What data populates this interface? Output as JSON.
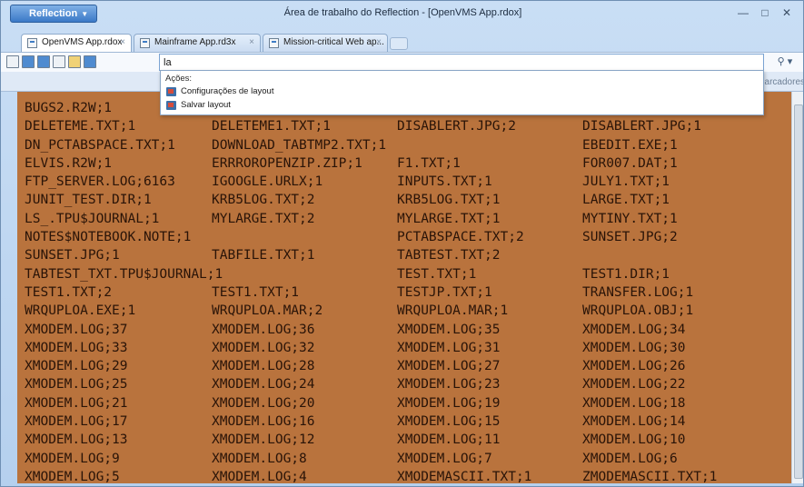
{
  "window": {
    "app_menu_label": "Reflection",
    "title": "Área de trabalho do Reflection - [OpenVMS App.rdox]",
    "minimize": "—",
    "maximize": "□",
    "close": "✕"
  },
  "tabs": [
    {
      "label": "OpenVMS App.rdox",
      "close": "×"
    },
    {
      "label": "Mainframe App.rd3x",
      "close": "×"
    },
    {
      "label": "Mission-critical Web ap...",
      "close": "×"
    }
  ],
  "search": {
    "value": "la",
    "button_label": "⚲ ▾"
  },
  "ribbon": {
    "right_text": "arcadores"
  },
  "dropdown": {
    "header": "Ações:",
    "items": [
      {
        "label": "Configurações de layout",
        "icon": "layout-settings-icon"
      },
      {
        "label": "Salvar layout",
        "icon": "save-layout-icon"
      }
    ]
  },
  "terminal": {
    "rows": [
      [
        "BUGS2.R2W;1",
        "",
        "",
        ""
      ],
      [
        "DELETEME.TXT;1",
        "DELETEME1.TXT;1",
        "DISABLERT.JPG;2",
        "DISABLERT.JPG;1"
      ],
      [
        "DN_PCTABSPACE.TXT;1",
        "DOWNLOAD_TABTMP2.TXT;1",
        "",
        "EBEDIT.EXE;1"
      ],
      [
        "ELVIS.R2W;1",
        "ERRROROPENZIP.ZIP;1",
        "F1.TXT;1",
        "FOR007.DAT;1"
      ],
      [
        "FTP_SERVER.LOG;6163",
        "IGOOGLE.URLX;1",
        "INPUTS.TXT;1",
        "JULY1.TXT;1"
      ],
      [
        "JUNIT_TEST.DIR;1",
        "KRB5LOG.TXT;2",
        "KRB5LOG.TXT;1",
        "LARGE.TXT;1"
      ],
      [
        "LS_.TPU$JOURNAL;1",
        "MYLARGE.TXT;2",
        "MYLARGE.TXT;1",
        "MYTINY.TXT;1"
      ],
      [
        "NOTES$NOTEBOOK.NOTE;1",
        "",
        "PCTABSPACE.TXT;2",
        "SUNSET.JPG;2"
      ],
      [
        "SUNSET.JPG;1",
        "TABFILE.TXT;1",
        "TABTEST.TXT;2",
        ""
      ],
      [
        "TABTEST_TXT.TPU$JOURNAL;1",
        "",
        "TEST.TXT;1",
        "TEST1.DIR;1"
      ],
      [
        "TEST1.TXT;2",
        "TEST1.TXT;1",
        "TESTJP.TXT;1",
        "TRANSFER.LOG;1"
      ],
      [
        "WRQUPLOA.EXE;1",
        "WRQUPLOA.MAR;2",
        "WRQUPLOA.MAR;1",
        "WRQUPLOA.OBJ;1"
      ],
      [
        "XMODEM.LOG;37",
        "XMODEM.LOG;36",
        "XMODEM.LOG;35",
        "XMODEM.LOG;34"
      ],
      [
        "XMODEM.LOG;33",
        "XMODEM.LOG;32",
        "XMODEM.LOG;31",
        "XMODEM.LOG;30"
      ],
      [
        "XMODEM.LOG;29",
        "XMODEM.LOG;28",
        "XMODEM.LOG;27",
        "XMODEM.LOG;26"
      ],
      [
        "XMODEM.LOG;25",
        "XMODEM.LOG;24",
        "XMODEM.LOG;23",
        "XMODEM.LOG;22"
      ],
      [
        "XMODEM.LOG;21",
        "XMODEM.LOG;20",
        "XMODEM.LOG;19",
        "XMODEM.LOG;18"
      ],
      [
        "XMODEM.LOG;17",
        "XMODEM.LOG;16",
        "XMODEM.LOG;15",
        "XMODEM.LOG;14"
      ],
      [
        "XMODEM.LOG;13",
        "XMODEM.LOG;12",
        "XMODEM.LOG;11",
        "XMODEM.LOG;10"
      ],
      [
        "XMODEM.LOG;9",
        "XMODEM.LOG;8",
        "XMODEM.LOG;7",
        "XMODEM.LOG;6"
      ],
      [
        "XMODEM.LOG;5",
        "XMODEM.LOG;4",
        "XMODEMASCII.TXT;1",
        "ZMODEMASCII.TXT;1"
      ]
    ]
  },
  "colors": {
    "terminal_bg": "#b9733d",
    "terminal_fg": "#2a1408"
  }
}
